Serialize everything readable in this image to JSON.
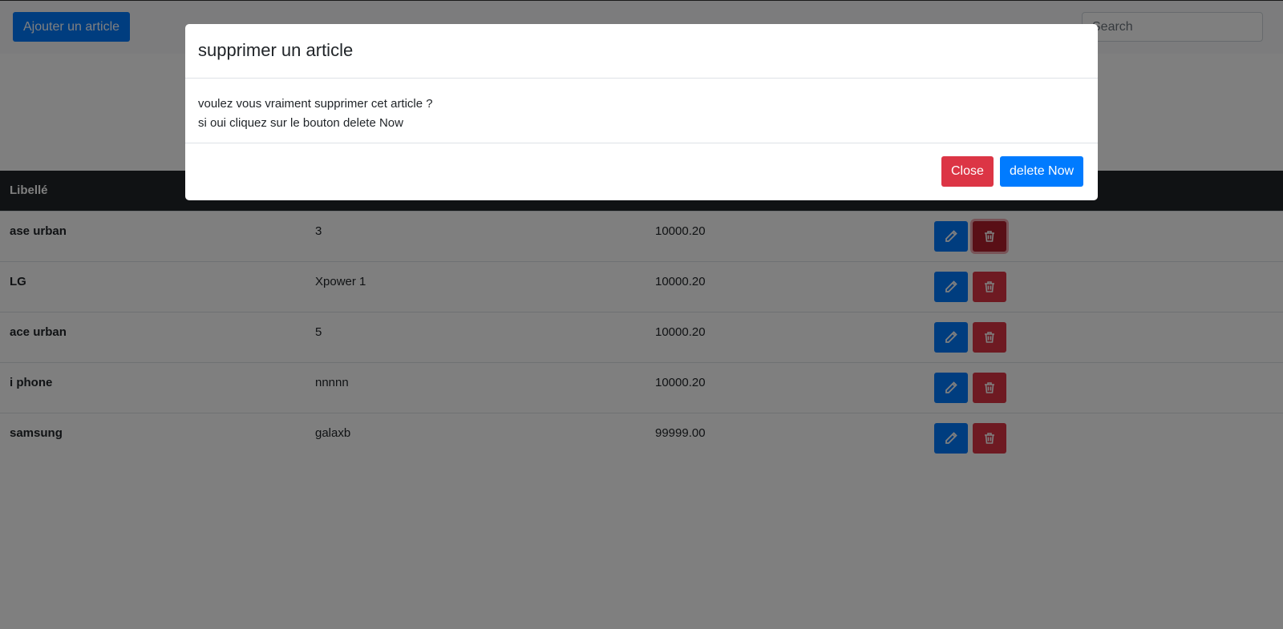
{
  "toolbar": {
    "add_label": "Ajouter un article",
    "search_placeholder": "Search"
  },
  "table": {
    "header_first": "Libellé",
    "rows": [
      {
        "libelle": "ase urban",
        "col2": "3",
        "col3": "10000.20"
      },
      {
        "libelle": "LG",
        "col2": "Xpower 1",
        "col3": "10000.20"
      },
      {
        "libelle": "ace urban",
        "col2": "5",
        "col3": "10000.20"
      },
      {
        "libelle": "i phone",
        "col2": "nnnnn",
        "col3": "10000.20"
      },
      {
        "libelle": "samsung",
        "col2": "galaxb",
        "col3": "99999.00"
      }
    ]
  },
  "modal": {
    "title": "supprimer un article",
    "line1": "voulez vous vraiment supprimer cet article ?",
    "line2": "si oui cliquez sur le bouton delete Now",
    "close_label": "Close",
    "delete_label": "delete Now"
  },
  "colors": {
    "primary": "#007bff",
    "danger": "#dc3545",
    "dark_header": "#212529"
  }
}
